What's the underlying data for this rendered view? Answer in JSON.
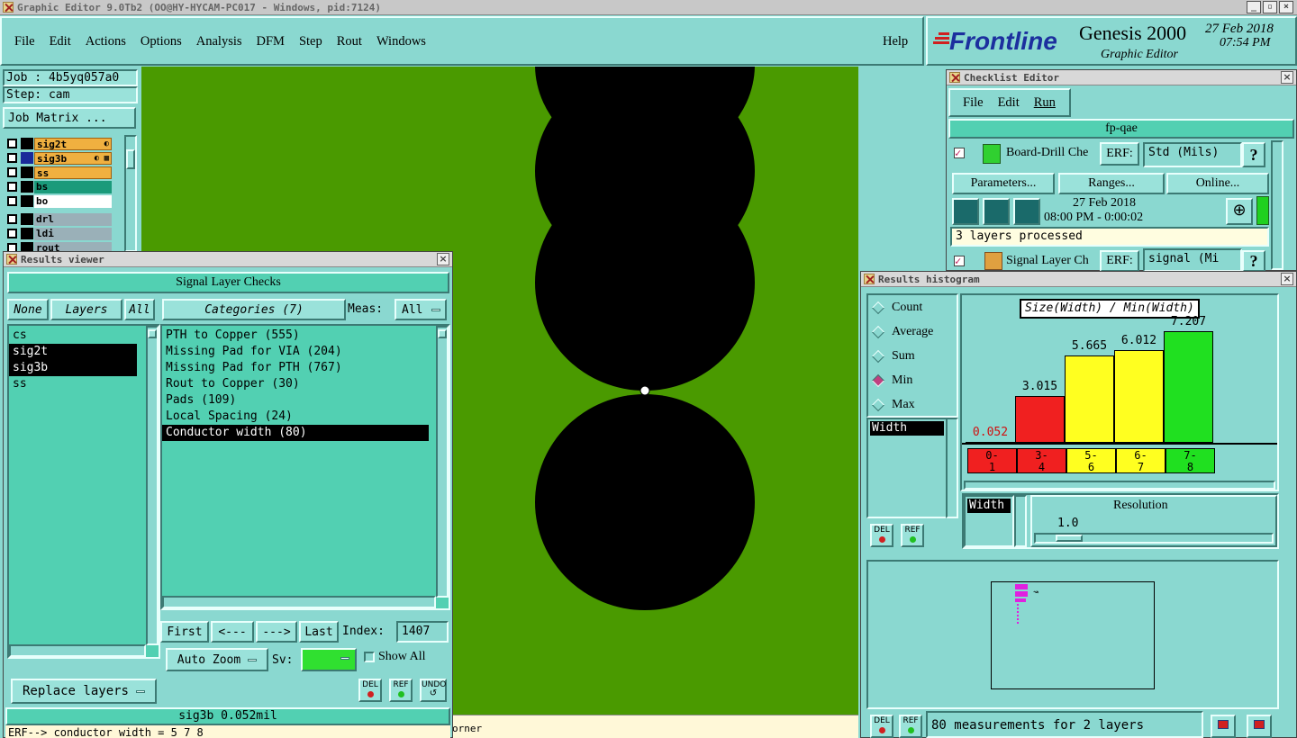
{
  "window": {
    "title": "Graphic Editor 9.0Tb2 (OO@HY-HYCAM-PC017 - Windows, pid:7124)"
  },
  "menu": {
    "items": [
      "File",
      "Edit",
      "Actions",
      "Options",
      "Analysis",
      "DFM",
      "Step",
      "Rout",
      "Windows"
    ],
    "help": "Help"
  },
  "brand": {
    "logo": "Frontline",
    "product": "Genesis 2000",
    "subtitle": "Graphic Editor",
    "date": "27 Feb 2018",
    "time": "07:54 PM"
  },
  "job": {
    "job_label": "Job : 4b5yq057a0",
    "step_label": "Step: cam",
    "matrix_button": "Job Matrix ..."
  },
  "layers": [
    {
      "name": "sig2t",
      "color": "#f0b040",
      "marks": "◐"
    },
    {
      "name": "sig3b",
      "color": "#f0b040",
      "marks": "◐ ▦"
    },
    {
      "name": "ss",
      "color": "#f0b040",
      "marks": ""
    },
    {
      "name": "bs",
      "color": "#1a9a7a",
      "marks": ""
    },
    {
      "name": "bo",
      "color": "#ffffff",
      "marks": ""
    },
    {
      "name": "drl",
      "color": "#9ab0b8",
      "marks": ""
    },
    {
      "name": "ldi",
      "color": "#9ab0b8",
      "marks": ""
    },
    {
      "name": "rout",
      "color": "#9ab0b8",
      "marks": ""
    }
  ],
  "results_viewer": {
    "title": "Results viewer",
    "header": "Signal Layer Checks",
    "none_btn": "None",
    "layers_btn": "Layers",
    "all_btn": "All",
    "categories_btn": "Categories (7)",
    "meas_label": "Meas:",
    "meas_value": "All",
    "layer_list": [
      "cs",
      "sig2t",
      "sig3b",
      "ss"
    ],
    "category_list": [
      "PTH to Copper (555)",
      "Missing Pad for VIA (204)",
      "Missing Pad for PTH (767)",
      "Rout to Copper (30)",
      "Pads (109)",
      "Local Spacing (24)",
      "Conductor width (80)"
    ],
    "first_btn": "First",
    "prev_btn": "<---",
    "next_btn": "--->",
    "last_btn": "Last",
    "index_label": "Index:",
    "index_value": "1407",
    "autozoom": "Auto Zoom",
    "sv_label": "Sv:",
    "show_all": "Show All",
    "replace_layers": "Replace layers",
    "del": "DEL",
    "ref": "REF",
    "undo": "UNDO",
    "status": "sig3b 0.052mil",
    "erf_line": "ERF--> conductor width = 5 7 8"
  },
  "canvas": {
    "corner_text": "orner"
  },
  "checklist": {
    "title": "Checklist Editor",
    "menu": [
      "File",
      "Edit",
      "Run"
    ],
    "name": "fp-qae",
    "action1": {
      "name": "Board-Drill Che",
      "erf": "ERF:",
      "erf_value": "Std (Mils)",
      "q": "?"
    },
    "buttons": [
      "Parameters...",
      "Ranges...",
      "Online..."
    ],
    "date": "27 Feb 2018",
    "time_range": "08:00 PM - 0:00:02",
    "processed": "3 layers processed",
    "action2": {
      "name": "Signal Layer Ch",
      "erf": "ERF:",
      "erf_value": "signal (Mi",
      "q": "?"
    }
  },
  "histogram": {
    "title": "Results histogram",
    "radios": [
      {
        "label": "Count",
        "on": false
      },
      {
        "label": "Average",
        "on": false
      },
      {
        "label": "Sum",
        "on": false
      },
      {
        "label": "Min",
        "on": true
      },
      {
        "label": "Max",
        "on": false
      }
    ],
    "measure": "Width",
    "chart_title": "Size(Width) / Min(Width)",
    "bars": [
      {
        "value": "0.052",
        "bin": "0-\n1",
        "color": "#f02020",
        "num": 0.052
      },
      {
        "value": "3.015",
        "bin": "3-\n4",
        "color": "#f02020",
        "num": 3.015
      },
      {
        "value": "5.665",
        "bin": "5-\n6",
        "color": "#ffff20",
        "num": 5.665
      },
      {
        "value": "6.012",
        "bin": "6-\n7",
        "color": "#ffff20",
        "num": 6.012
      },
      {
        "value": "7.207",
        "bin": "7-\n8",
        "color": "#20e020",
        "num": 7.207
      }
    ],
    "width_label": "Width",
    "resolution_label": "Resolution",
    "resolution_value": "1.0",
    "del": "DEL",
    "ref": "REF",
    "measurements": "80 measurements for 2 layers"
  }
}
